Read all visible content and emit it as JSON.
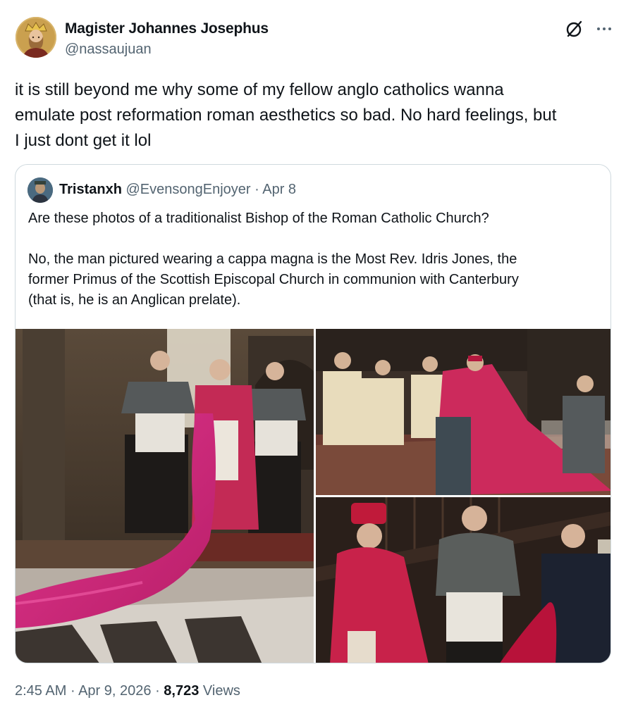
{
  "post": {
    "author_name": "Magister Johannes Josephus",
    "author_handle": "@nassaujuan",
    "text_line1": "it is still beyond me why some of my fellow anglo catholics wanna",
    "text_line2": "emulate post reformation roman aesthetics so bad. No hard feelings, but",
    "text_line3": "I just dont get it lol",
    "icons": {
      "grok": "grok-icon",
      "more": "more-icon"
    }
  },
  "quote": {
    "author_name": "Tristanxh",
    "author_handle": "@EvensongEnjoyer",
    "separator": "·",
    "date": "Apr 8",
    "paragraph1": "Are these photos of a traditionalist Bishop of the Roman Catholic Church?",
    "paragraph2_line1": "No, the man pictured wearing a cappa magna is the Most Rev. Idris Jones, the",
    "paragraph2_line2": "former Primus of the Scottish Episcopal Church in communion with Canterbury",
    "paragraph2_line3": "(that is, he is an Anglican prelate).",
    "photo_count": 3
  },
  "footer": {
    "time": "2:45 AM",
    "sep1": "·",
    "date": "Apr 9, 2026",
    "sep2": "·",
    "views_count": "8,723",
    "views_label": "Views"
  },
  "colors": {
    "text": "#0f1419",
    "muted": "#536471",
    "border": "#cfd9de",
    "cappa_magenta": "#d12c7e",
    "cappa_red": "#c0184a"
  }
}
